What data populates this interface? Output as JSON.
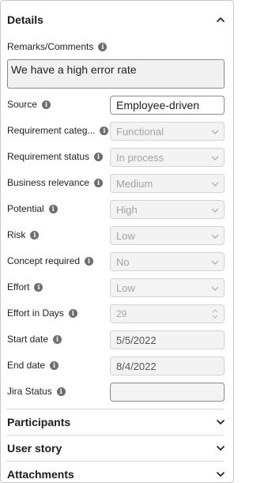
{
  "details": {
    "title": "Details",
    "remarks": {
      "label": "Remarks/Comments",
      "value": "We have a high error rate"
    },
    "fields": [
      {
        "label": "Source",
        "value": "Employee-driven",
        "kind": "text-active"
      },
      {
        "label": "Requirement categ...",
        "value": "Functional",
        "kind": "select"
      },
      {
        "label": "Requirement status",
        "value": "In process",
        "kind": "select"
      },
      {
        "label": "Business relevance",
        "value": "Medium",
        "kind": "select"
      },
      {
        "label": "Potential",
        "value": "High",
        "kind": "select"
      },
      {
        "label": "Risk",
        "value": "Low",
        "kind": "select"
      },
      {
        "label": "Concept required",
        "value": "No",
        "kind": "select"
      },
      {
        "label": "Effort",
        "value": "Low",
        "kind": "select"
      },
      {
        "label": "Effort in Days",
        "value": "29",
        "kind": "number"
      },
      {
        "label": "Start date",
        "value": "5/5/2022",
        "kind": "date"
      },
      {
        "label": "End date",
        "value": "8/4/2022",
        "kind": "date"
      },
      {
        "label": "Jira Status",
        "value": "",
        "kind": "text-empty"
      }
    ]
  },
  "sections": [
    {
      "title": "Participants",
      "icon": "chevron-down-icon"
    },
    {
      "title": "User story",
      "icon": "chevron-down-icon"
    },
    {
      "title": "Attachments",
      "icon": "chevron-down-icon"
    }
  ],
  "icons": {
    "collapse": "chevron-up-icon",
    "info": "info-icon"
  },
  "colors": {
    "info_icon": "#6e6e6e",
    "disabled_field_bg": "#f3f3f3",
    "divider": "#d6d6d6"
  }
}
